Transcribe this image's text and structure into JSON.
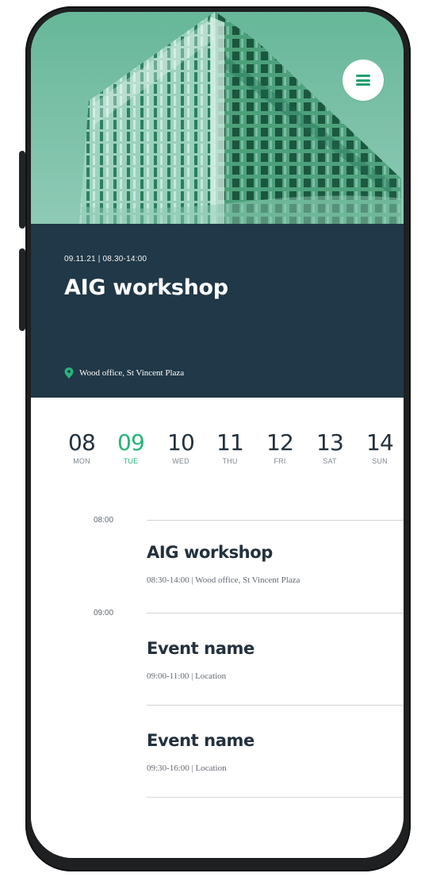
{
  "hero": {
    "menu_icon": "hamburger-menu-icon",
    "background_color": "#75bea3"
  },
  "event": {
    "date_time": "09.11.21 | 08.30-14:00",
    "title": "AIG workshop",
    "location": "Wood office, St Vincent Plaza",
    "location_icon": "map-pin-icon",
    "header_color": "#203847",
    "accent_color": "#29b37a"
  },
  "week": {
    "days": [
      {
        "num": "08",
        "name": "MON"
      },
      {
        "num": "09",
        "name": "TUE",
        "active": true
      },
      {
        "num": "10",
        "name": "WED"
      },
      {
        "num": "11",
        "name": "THU"
      },
      {
        "num": "12",
        "name": "FRI"
      },
      {
        "num": "13",
        "name": "SAT"
      },
      {
        "num": "14",
        "name": "SUN"
      }
    ]
  },
  "timeline": {
    "labels": [
      "08:00",
      "09:00"
    ],
    "events": [
      {
        "name": "AIG workshop",
        "meta": "08:30-14:00 | Wood office, St Vincent Plaza"
      },
      {
        "name": "Event name",
        "meta": "09:00-11:00 | Location"
      },
      {
        "name": "Event name",
        "meta": "09:30-16:00 | Location"
      }
    ]
  }
}
